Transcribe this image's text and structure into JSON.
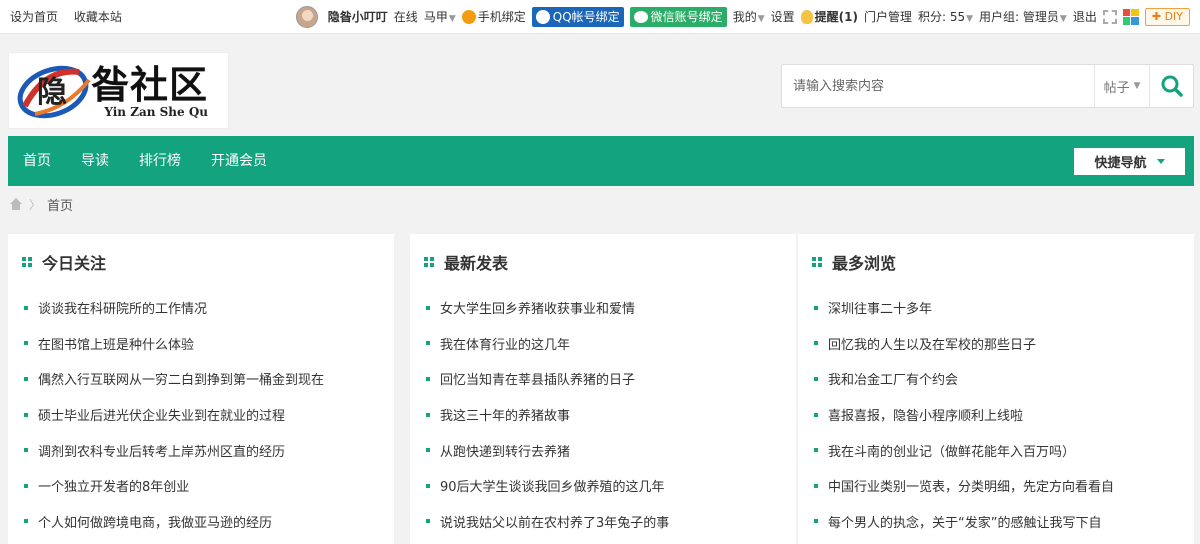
{
  "topbar": {
    "left_links": [
      "设为首页",
      "收藏本站"
    ],
    "username": "隐昝小叮叮",
    "online": "在线",
    "majia": "马甲",
    "phone_bind": "手机绑定",
    "qq_bind": "QQ帐号绑定",
    "wx_bind": "微信账号绑定",
    "mine": "我的",
    "settings": "设置",
    "remind": "提醒(1)",
    "portal_admin": "门户管理",
    "points": "积分: 55",
    "usergroup": "用户组: 管理员",
    "logout": "退出",
    "diy": "DIY"
  },
  "logo": {
    "cn": "昝社区",
    "en": "Yin Zan She Qu"
  },
  "search": {
    "placeholder": "请输入搜索内容",
    "scope": "帖子"
  },
  "nav": {
    "items": [
      "首页",
      "导读",
      "排行榜",
      "开通会员"
    ],
    "quick": "快捷导航"
  },
  "breadcrumb": {
    "current": "首页"
  },
  "panels": [
    {
      "title": "今日关注",
      "items": [
        "谈谈我在科研院所的工作情况",
        "在图书馆上班是种什么体验",
        "偶然入行互联网从一穷二白到挣到第一桶金到现在",
        "硕士毕业后进光伏企业失业到在就业的过程",
        "调剂到农科专业后转考上岸苏州区直的经历",
        "一个独立开发者的8年创业",
        "个人如何做跨境电商，我做亚马逊的经历"
      ]
    },
    {
      "title": "最新发表",
      "items": [
        "女大学生回乡养猪收获事业和爱情",
        "我在体育行业的这几年",
        "回忆当知青在莘县插队养猪的日子",
        "我这三十年的养猪故事",
        "从跑快递到转行去养猪",
        "90后大学生谈谈我回乡做养殖的这几年",
        "说说我姑父以前在农村养了3年兔子的事"
      ]
    },
    {
      "title": "最多浏览",
      "items": [
        "深圳往事二十多年",
        "回忆我的人生以及在军校的那些日子",
        "我和冶金工厂有个约会",
        "喜报喜报，隐昝小程序顺利上线啦",
        "我在斗南的创业记（做鲜花能年入百万吗）",
        "中国行业类别一览表，分类明细，先定方向看看自",
        "每个男人的执念，关于“发家”的感触让我写下自"
      ]
    }
  ],
  "colors": {
    "brand": "#14a37f",
    "qq": "#1a66b8",
    "wechat": "#2aae67"
  }
}
